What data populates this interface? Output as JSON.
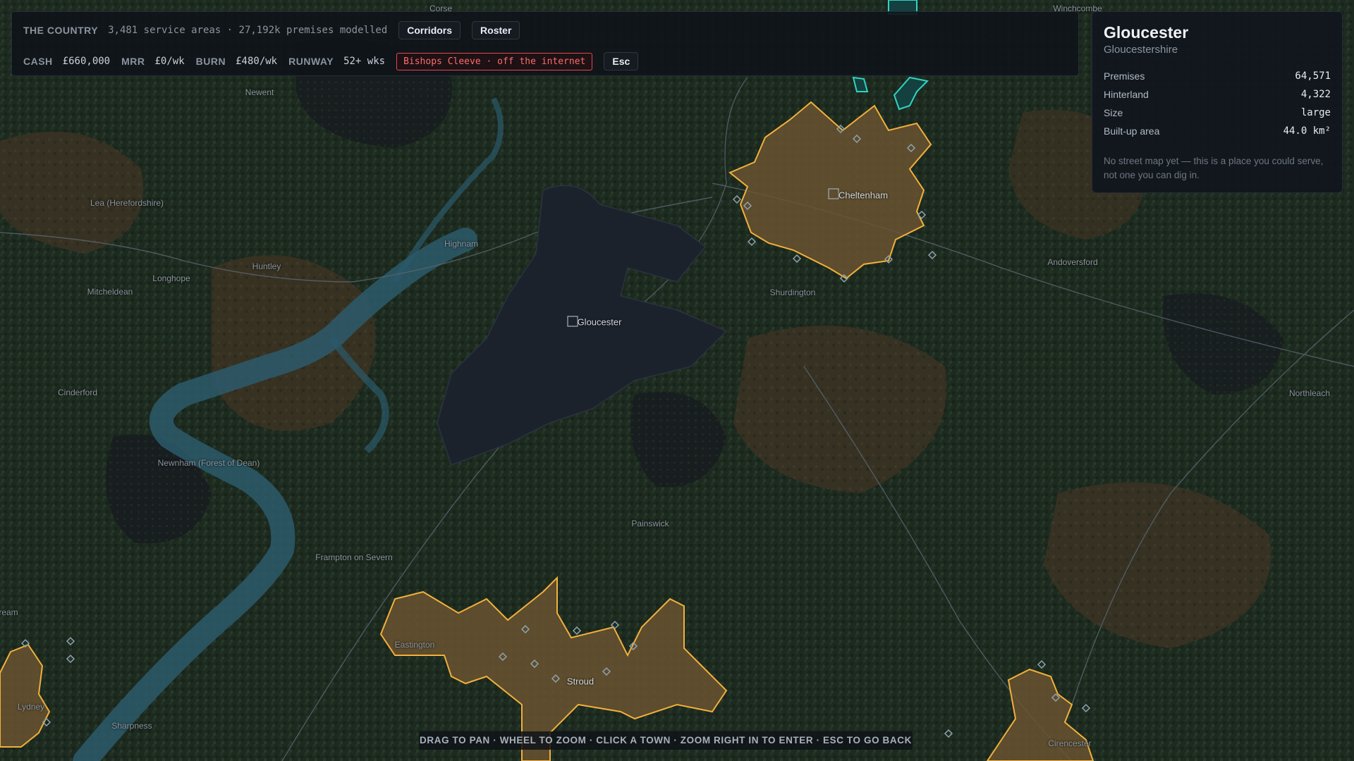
{
  "hud": {
    "country_label": "THE COUNTRY",
    "stats_text": "3,481 service areas · 27,192k premises modelled",
    "corridors_btn": "Corridors",
    "roster_btn": "Roster",
    "cash_label": "CASH",
    "cash_value": "£660,000",
    "mrr_label": "MRR",
    "mrr_value": "£0/wk",
    "burn_label": "BURN",
    "burn_value": "£480/wk",
    "runway_label": "RUNWAY",
    "runway_value": "52+ wks",
    "alert": "Bishops Cleeve · off the internet",
    "esc_btn": "Esc"
  },
  "info": {
    "title": "Gloucester",
    "subtitle": "Gloucestershire",
    "rows": [
      {
        "label": "Premises",
        "value": "64,571"
      },
      {
        "label": "Hinterland",
        "value": "4,322"
      },
      {
        "label": "Size",
        "value": "large"
      },
      {
        "label": "Built-up area",
        "value": "44.0 km²"
      }
    ],
    "note": "No street map yet — this is a place you could serve, not one you can dig in."
  },
  "hint": "DRAG TO PAN · WHEEL TO ZOOM · CLICK A TOWN · ZOOM RIGHT IN TO ENTER · ESC TO GO BACK",
  "towns": [
    {
      "name": "Corse"
    },
    {
      "name": "Winchcombe"
    },
    {
      "name": "Newent"
    },
    {
      "name": "Lea (Herefordshire)"
    },
    {
      "name": "Highnam"
    },
    {
      "name": "Huntley"
    },
    {
      "name": "Longhope"
    },
    {
      "name": "Mitcheldean"
    },
    {
      "name": "Gloucester"
    },
    {
      "name": "Cheltenham"
    },
    {
      "name": "Shurdington"
    },
    {
      "name": "Andoversford"
    },
    {
      "name": "Cinderford"
    },
    {
      "name": "Northleach"
    },
    {
      "name": "Newnham (Forest of Dean)"
    },
    {
      "name": "Painswick"
    },
    {
      "name": "Frampton on Severn"
    },
    {
      "name": "ream"
    },
    {
      "name": "Eastington"
    },
    {
      "name": "Stroud"
    },
    {
      "name": "Lydney"
    },
    {
      "name": "Sharpness"
    },
    {
      "name": "Cirencester"
    }
  ],
  "colors": {
    "served": "#e8a83a",
    "selected": "#1e2430",
    "teal": "#2fd4c4",
    "alert": "#e5484d"
  }
}
